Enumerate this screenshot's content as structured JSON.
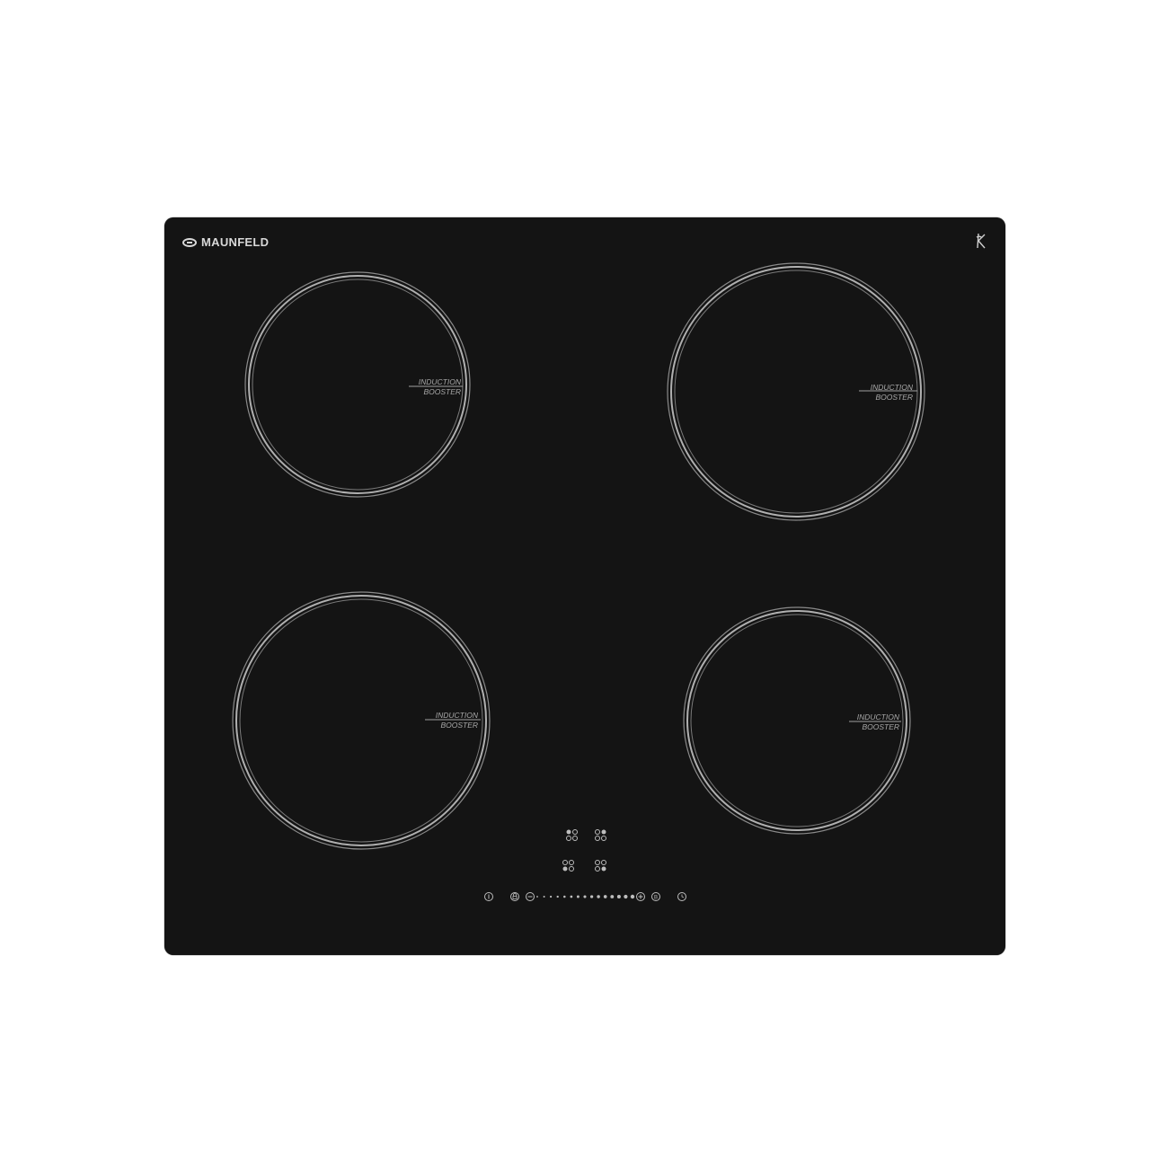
{
  "brand": {
    "name": "MAUNFELD",
    "logo_icon": "maunfeld-logo-icon",
    "mark_icon": "k-mark-icon"
  },
  "zones": [
    {
      "id": "top-left",
      "line1": "INDUCTION",
      "line2": "BOOSTER"
    },
    {
      "id": "top-right",
      "line1": "INDUCTION",
      "line2": "BOOSTER"
    },
    {
      "id": "bottom-left",
      "line1": "INDUCTION",
      "line2": "BOOSTER"
    },
    {
      "id": "bottom-right",
      "line1": "INDUCTION",
      "line2": "BOOSTER"
    }
  ],
  "controls": {
    "power": "power-icon",
    "lock": "lock-icon",
    "minus": "minus-icon",
    "plus": "plus-icon",
    "booster": "B",
    "timer": "timer-icon",
    "slider_steps": 15
  },
  "colors": {
    "glass": "#141414",
    "ring": "#9a9a9a",
    "text": "#a8a8a8"
  }
}
